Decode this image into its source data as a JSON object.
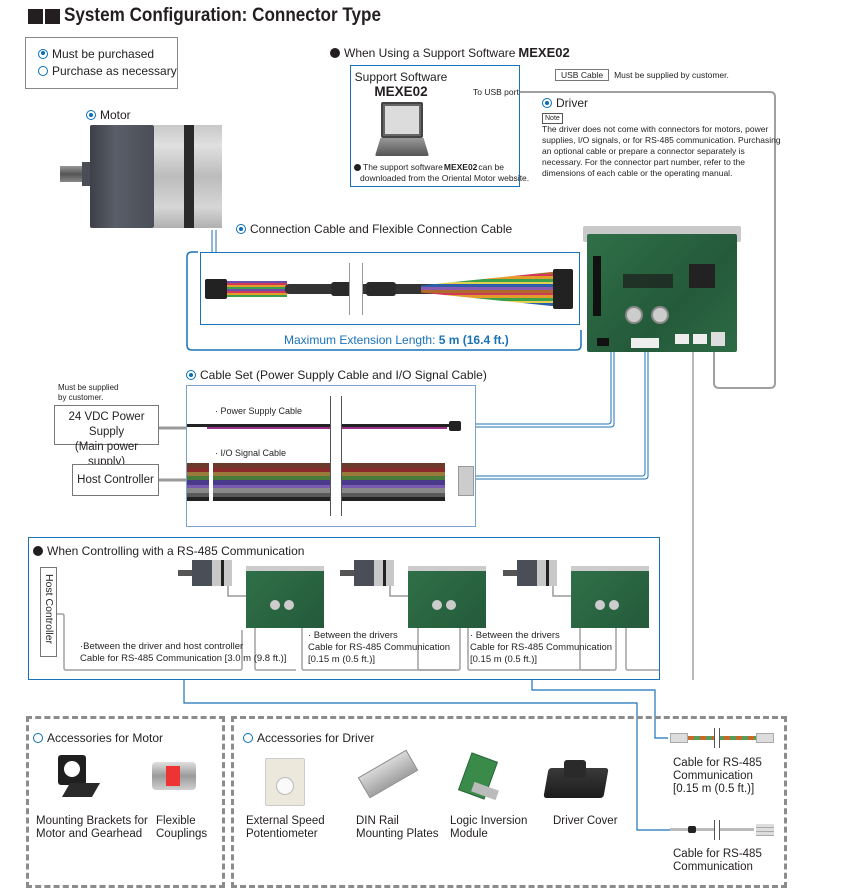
{
  "title": "System Configuration: Connector Type",
  "legend": {
    "must": "Must be purchased",
    "optional": "Purchase as necessary"
  },
  "motor": {
    "label": "Motor"
  },
  "support_software": {
    "heading_prefix": "When Using a Support Software ",
    "heading_product": "MEXE02",
    "box_title": "Support Software",
    "box_product": "MEXE02",
    "usb_port": "To USB port",
    "note_prefix": "The support software ",
    "note_product": "MEXE02",
    "note_suffix": " can be",
    "note_line2": "downloaded from the Oriental Motor website."
  },
  "usb_cable": {
    "tag": "USB Cable",
    "note": "Must be supplied by customer."
  },
  "driver": {
    "label": "Driver",
    "note_tag": "Note",
    "note_lines": [
      "The driver does not come with connectors for motors, power",
      "supplies, I/O signals, or for RS-485 communication. Purchasing",
      "an optional cable or prepare a connector separately is",
      "necessary. For the connector part number, refer to the",
      "dimensions of each cable or the operating manual."
    ]
  },
  "connection_cable": {
    "label": "Connection Cable and Flexible Connection Cable",
    "max_length_prefix": "Maximum Extension Length: ",
    "max_length_value": "5 m (16.4 ft.)"
  },
  "cable_set": {
    "label": "Cable Set (Power Supply Cable and I/O Signal Cable)",
    "power_cable": "· Power Supply Cable",
    "io_cable": "· I/O Signal Cable"
  },
  "customer_supplied": {
    "line1": "Must be supplied",
    "line2": "by customer."
  },
  "power_supply": {
    "line1": "24 VDC Power Supply",
    "line2": "(Main power supply)"
  },
  "host_controller": {
    "label": "Host Controller"
  },
  "rs485": {
    "heading": "When Controlling with a RS-485 Communication",
    "host_label": "Host Controller",
    "captions": [
      {
        "line1": "·Between the driver and host controller",
        "line2": "Cable for RS-485 Communication [3.0 m (9.8 ft.)]",
        "line3": ""
      },
      {
        "line1": "· Between the drivers",
        "line2": "Cable for RS-485 Communication",
        "line3": "[0.15 m (0.5 ft.)]"
      },
      {
        "line1": "· Between the drivers",
        "line2": "Cable for RS-485 Communication",
        "line3": "[0.15 m (0.5 ft.)]"
      }
    ]
  },
  "accessories_motor": {
    "heading": "Accessories for Motor",
    "items": [
      {
        "line1": "Mounting Brackets for",
        "line2": "Motor and Gearhead"
      },
      {
        "line1": "Flexible",
        "line2": "Couplings"
      }
    ]
  },
  "accessories_driver": {
    "heading": "Accessories for Driver",
    "items": [
      {
        "line1": "External Speed",
        "line2": "Potentiometer"
      },
      {
        "line1": "DIN Rail",
        "line2": "Mounting Plates"
      },
      {
        "line1": "Logic Inversion",
        "line2": "Module"
      },
      {
        "line1": "Driver Cover",
        "line2": ""
      }
    ]
  },
  "rs485_cables": [
    {
      "line1": "Cable for RS-485",
      "line2": "Communication",
      "line3": "[0.15 m (0.5 ft.)]"
    },
    {
      "line1": "Cable for RS-485",
      "line2": "Communication",
      "line3": ""
    }
  ],
  "colors": {
    "accent_blue": "#1a72b8",
    "text": "#231f20",
    "line_grey": "#8c8c8c",
    "pcb_green": "#2e6b45"
  }
}
